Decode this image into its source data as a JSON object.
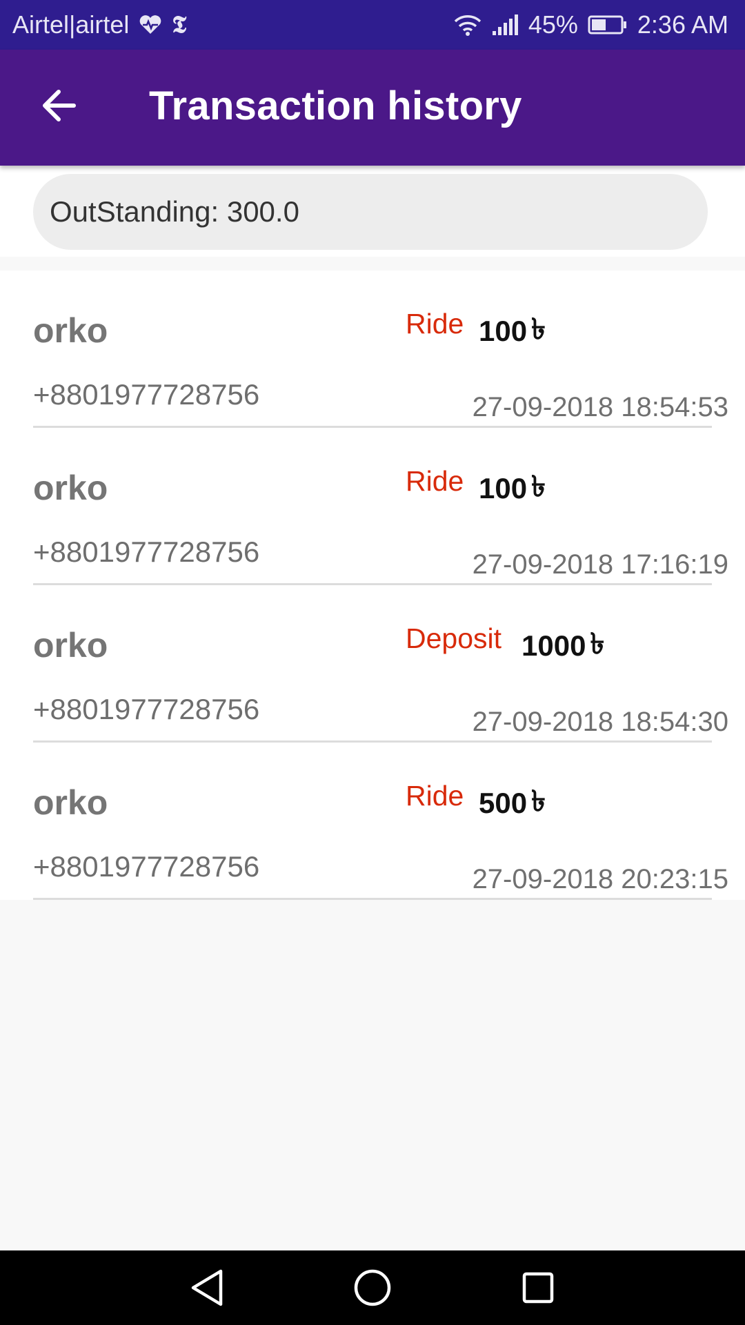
{
  "status_bar": {
    "carrier": "Airtel|airtel",
    "battery": "45%",
    "time": "2:36 AM"
  },
  "app_bar": {
    "title": "Transaction history",
    "back_icon": "arrow-back-icon"
  },
  "outstanding": {
    "text": "OutStanding: 300.0"
  },
  "currency_symbol": "৳",
  "transactions": [
    {
      "name": "orko",
      "phone": "+8801977728756",
      "type": "Ride",
      "amount": "100",
      "date": "27-09-2018 18:54:53"
    },
    {
      "name": "orko",
      "phone": "+8801977728756",
      "type": "Ride",
      "amount": "100",
      "date": "27-09-2018 17:16:19"
    },
    {
      "name": "orko",
      "phone": "+8801977728756",
      "type": "Deposit",
      "amount": "1000",
      "date": "27-09-2018 18:54:30"
    },
    {
      "name": "orko",
      "phone": "+8801977728756",
      "type": "Ride",
      "amount": "500",
      "date": "27-09-2018 20:23:15"
    }
  ],
  "nav_bar": {
    "icons": [
      "back-triangle-icon",
      "home-circle-icon",
      "recents-square-icon"
    ]
  },
  "colors": {
    "status_bar": "#2f1d8f",
    "app_bar": "#4b1888",
    "type_text": "#d82a0a"
  }
}
